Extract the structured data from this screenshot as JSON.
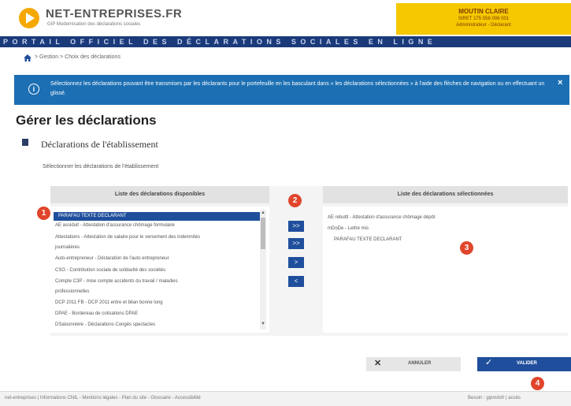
{
  "header": {
    "logo_title": "NET-ENTREPRISES.FR",
    "logo_subtitle": "GIP Modernisation des déclarations sociales",
    "user_name": "MOUTIN CLAIRE",
    "user_line1": "SIRET 175 556 006 001",
    "user_line2": "Administrateur - Déclarant",
    "portal_title": "PORTAIL OFFICIEL DES DÉCLARATIONS SOCIALES EN LIGNE"
  },
  "breadcrumb": "> Gestion > Choix des déclarations",
  "info": {
    "text": "Sélectionnez les déclarations pouvant être transmises par les déclarants pour le portefeuille en les basculant dans « les déclarations sélectionnées » à l'aide des flèches de navigation ou en effectuant un glissé.",
    "close": "×",
    "icon": "i"
  },
  "page_title": "Gérer les déclarations",
  "section_title": "Déclarations de l'établissement",
  "instruction": "Sélectionner les déclarations de l'établissement",
  "available": {
    "header": "Liste des déclarations disponibles",
    "items": [
      "PARAFAU TEXTE DECLARANT",
      "AE assiduit - Attestation d'assurance chômage formulaire",
      "Attestations - Attestation de salaire pour le versement des indemnités",
      "journalières",
      "Auto-entrepreneur - Déclaration de l'auto entrepreneur",
      "CSG - Contribution sociale de solidarité des sociétés",
      "Compte C3P - mise compte accidents du travail / maladies",
      "professionnelles",
      "DCP 2011 FB - DCP 2011 entre et bilan bonne long",
      "DPAE - Bordereau de cotisations DPAE",
      "DSaisonnière - Déclarations Congés spectacles"
    ]
  },
  "selected": {
    "header": "Liste des déclarations sélectionnées",
    "items": [
      "AE rebutlt - Attestation d'assurance chômage dépôt",
      "mDoDe - Lettre mis",
      "PARAFAU TEXTE DECLARANT"
    ]
  },
  "move_buttons": [
    ">>",
    ">>",
    ">",
    "<"
  ],
  "markers": [
    "1",
    "2",
    "3",
    "4"
  ],
  "actions": {
    "cancel_icon": "✕",
    "cancel_label": "ANNULER",
    "validate_icon": "✓",
    "validate_label": "VALIDER"
  },
  "footer": {
    "left": "net-entreprises  |  Informations CNIL - Mentions légales - Plan du site - Glossaire - Accessibilité",
    "right": "Besoin : gipmdsfr  |  accès"
  },
  "colors": {
    "brand_blue": "#1f4f9c",
    "banner_blue": "#1c6fb3",
    "header_yellow": "#f5c800",
    "marker_red": "#e0452b"
  }
}
